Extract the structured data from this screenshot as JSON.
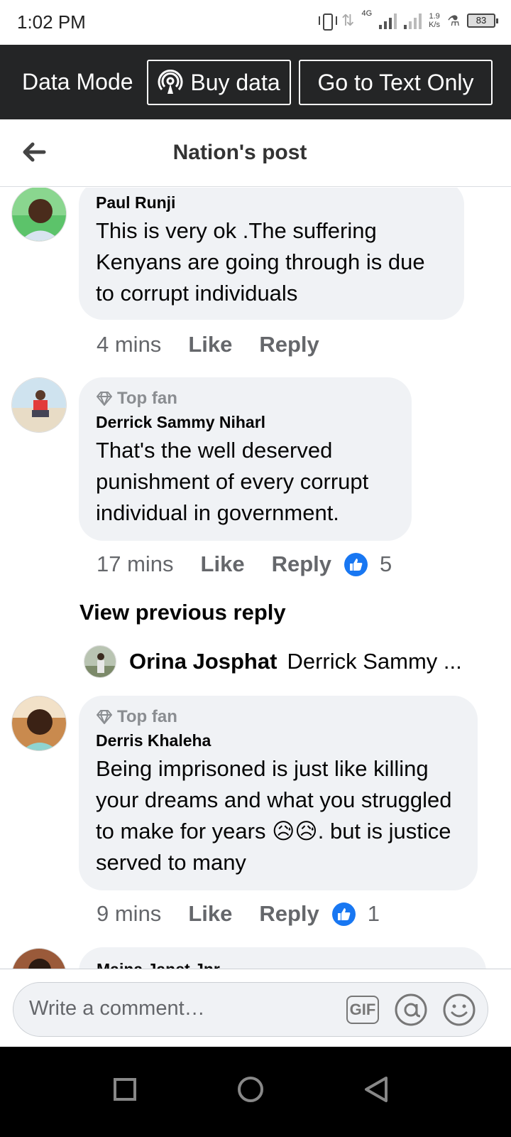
{
  "status_bar": {
    "time": "1:02 PM",
    "network_type": "4G",
    "speed_value": "1.9",
    "speed_unit": "K/s",
    "battery": "83"
  },
  "data_bar": {
    "mode_label": "Data Mode",
    "buy_data_label": "Buy data",
    "text_only_label": "Go to Text Only"
  },
  "header": {
    "title": "Nation's post"
  },
  "comments": [
    {
      "author": "Paul Runji",
      "text": "This is very ok .The suffering Kenyans are going through is due to corrupt individuals",
      "time": "4 mins",
      "like_label": "Like",
      "reply_label": "Reply"
    },
    {
      "badge": "Top fan",
      "author": "Derrick Sammy Niharl",
      "text": "That's the well deserved punishment of every corrupt individual in government.",
      "time": "17 mins",
      "like_label": "Like",
      "reply_label": "Reply",
      "reactions": "5"
    },
    {
      "badge": "Top fan",
      "author": "Derris Khaleha",
      "text": "Being imprisoned is just like killing your dreams and what you struggled to make for years 😥😥. but is justice served to many",
      "time": "9 mins",
      "like_label": "Like",
      "reply_label": "Reply",
      "reactions": "1"
    },
    {
      "author": "Maina Janet Jnr"
    }
  ],
  "replies": {
    "view_previous_label": "View previous reply",
    "reply_author": "Orina Josphat",
    "reply_snippet": "Derrick Sammy ..."
  },
  "composer": {
    "placeholder": "Write a comment…",
    "gif_label": "GIF"
  },
  "colors": {
    "accent": "#1877f2",
    "bubble": "#f0f2f5",
    "data_bar": "#242526",
    "muted": "#65676b"
  }
}
